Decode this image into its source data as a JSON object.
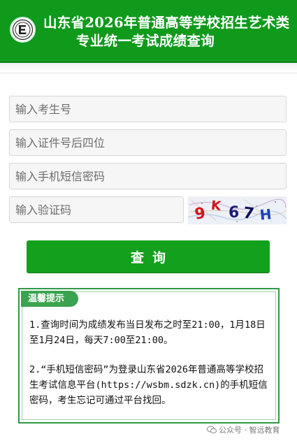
{
  "header": {
    "title_line1": "山东省2026年普通高等学校招生艺术类",
    "title_line2": "专业统一考试成绩查询",
    "logo_icon": "exam-authority-logo-icon"
  },
  "form": {
    "exam_number_placeholder": "输入考生号",
    "id_last4_placeholder": "输入证件号后四位",
    "sms_password_placeholder": "输入手机短信密码",
    "captcha_placeholder": "输入验证码",
    "captcha_text": "9K67H",
    "submit_label": "查询"
  },
  "notice": {
    "tag": "温馨提示",
    "item1": "1.查询时间为成绩发布当日发布之时至21:00，1月18日至1月24日，每天7:00至21:00。",
    "item2": "2.“手机短信密码”为登录山东省2026年普通高等学校招生考试信息平台(https://wsbm.sdzk.cn)的手机短信密码，考生忘记可通过平台找回。"
  },
  "watermark": {
    "text": "公众号 · 智远教育",
    "icon": "wechat-icon"
  },
  "colors": {
    "header_green": "#0f9a1c",
    "button_green": "#13a01c",
    "notice_border": "#2f9a45"
  }
}
